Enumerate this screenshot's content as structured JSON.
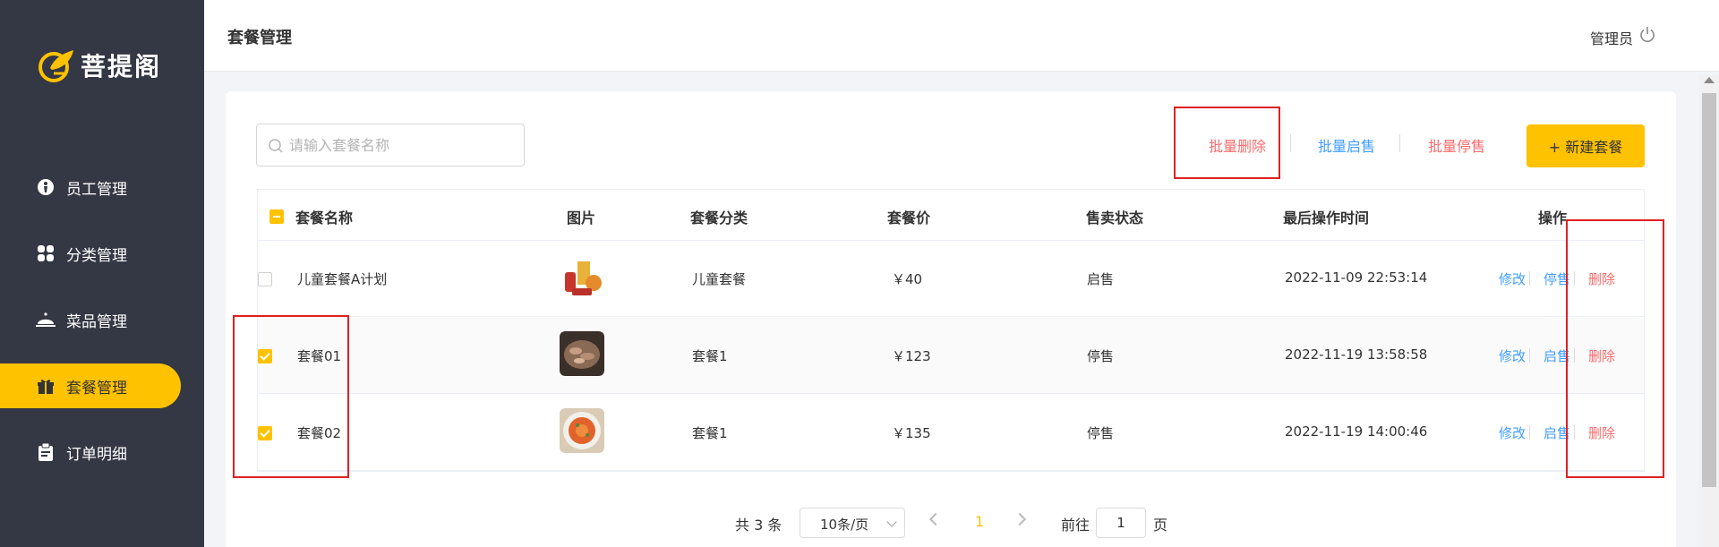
{
  "brand": {
    "name": "菩提阁"
  },
  "sidebar": {
    "items": [
      {
        "label": "员工管理",
        "icon": "employee-icon",
        "active": false
      },
      {
        "label": "分类管理",
        "icon": "category-icon",
        "active": false
      },
      {
        "label": "菜品管理",
        "icon": "dish-icon",
        "active": false
      },
      {
        "label": "套餐管理",
        "icon": "gift-icon",
        "active": true
      },
      {
        "label": "订单明细",
        "icon": "clipboard-icon",
        "active": false
      }
    ]
  },
  "header": {
    "title": "套餐管理",
    "user": "管理员",
    "icon": "power-icon"
  },
  "toolbar": {
    "search_placeholder": "请输入套餐名称",
    "batch_delete": "批量删除",
    "batch_enable": "批量启售",
    "batch_disable": "批量停售",
    "new_button": "+ 新建套餐"
  },
  "table": {
    "columns": [
      "套餐名称",
      "图片",
      "套餐分类",
      "套餐价",
      "售卖状态",
      "最后操作时间",
      "操作"
    ],
    "rows": [
      {
        "checked": false,
        "name": "儿童套餐A计划",
        "image": "kids-meal-photo",
        "category": "儿童套餐",
        "price": "￥40",
        "status": "启售",
        "updated": "2022-11-09 22:53:14",
        "op_edit": "修改",
        "op_toggle": "停售",
        "op_delete": "删除"
      },
      {
        "checked": true,
        "name": "套餐01",
        "image": "crayfish-photo",
        "category": "套餐1",
        "price": "￥123",
        "status": "停售",
        "updated": "2022-11-19 13:58:58",
        "op_edit": "修改",
        "op_toggle": "启售",
        "op_delete": "删除"
      },
      {
        "checked": true,
        "name": "套餐02",
        "image": "shrimp-plate-photo",
        "category": "套餐1",
        "price": "￥135",
        "status": "停售",
        "updated": "2022-11-19 14:00:46",
        "op_edit": "修改",
        "op_toggle": "启售",
        "op_delete": "删除"
      }
    ]
  },
  "pagination": {
    "total": "共 3 条",
    "page_size": "10条/页",
    "current_page": "1",
    "goto_label": "前往",
    "goto_value": "1",
    "goto_suffix": "页"
  },
  "colors": {
    "accent": "#ffc200",
    "sidebar_bg": "#343744",
    "link_blue": "#419eff",
    "link_red": "#f56c6c",
    "annotation": "#e02020"
  }
}
